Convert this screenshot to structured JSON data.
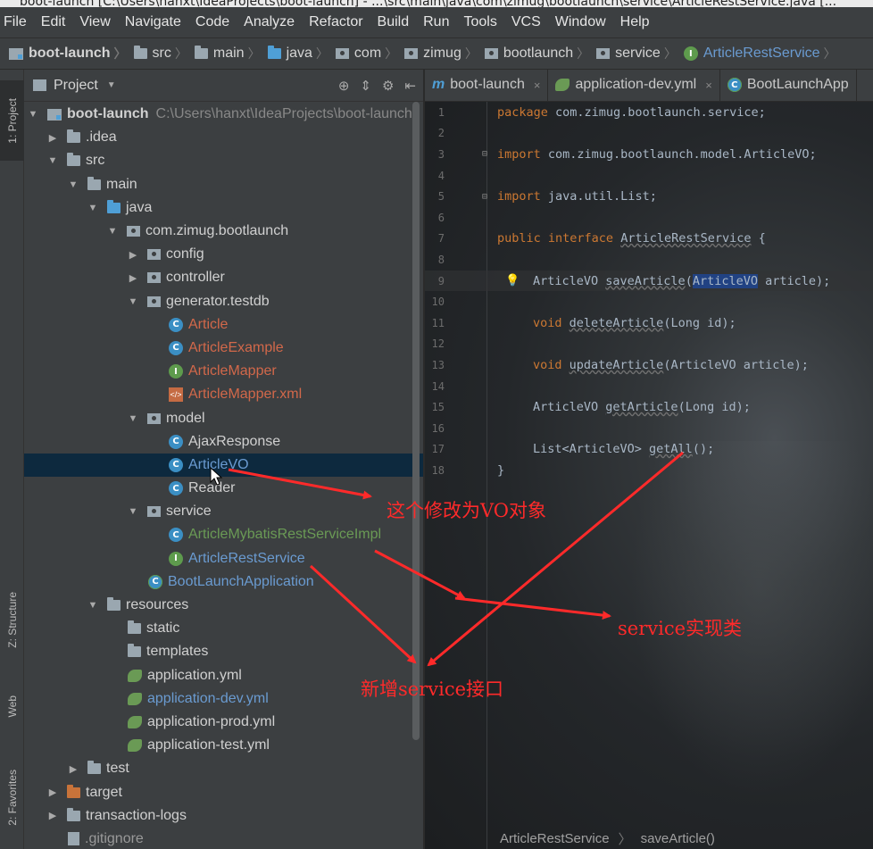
{
  "window": {
    "title": "boot-launch [C:\\Users\\hanxt\\IdeaProjects\\boot-launch] - ...\\src\\main\\java\\com\\zimug\\bootlaunch\\service\\ArticleRestService.java [..."
  },
  "menu": [
    "File",
    "Edit",
    "View",
    "Navigate",
    "Code",
    "Analyze",
    "Refactor",
    "Build",
    "Run",
    "Tools",
    "VCS",
    "Window",
    "Help"
  ],
  "breadcrumb": [
    "boot-launch",
    "src",
    "main",
    "java",
    "com",
    "zimug",
    "bootlaunch",
    "service",
    "ArticleRestService"
  ],
  "left_tabs": {
    "project": "1: Project",
    "structure": "Z: Structure",
    "web": "Web",
    "favorites": "2: Favorites"
  },
  "project_panel": {
    "title": "Project",
    "tree": [
      {
        "label": "boot-launch",
        "path": "C:\\Users\\hanxt\\IdeaProjects\\boot-launch"
      },
      {
        "label": ".idea"
      },
      {
        "label": "src"
      },
      {
        "label": "main"
      },
      {
        "label": "java"
      },
      {
        "label": "com.zimug.bootlaunch"
      },
      {
        "label": "config"
      },
      {
        "label": "controller"
      },
      {
        "label": "generator.testdb"
      },
      {
        "label": "Article"
      },
      {
        "label": "ArticleExample"
      },
      {
        "label": "ArticleMapper"
      },
      {
        "label": "ArticleMapper.xml"
      },
      {
        "label": "model"
      },
      {
        "label": "AjaxResponse"
      },
      {
        "label": "ArticleVO"
      },
      {
        "label": "Reader"
      },
      {
        "label": "service"
      },
      {
        "label": "ArticleMybatisRestServiceImpl"
      },
      {
        "label": "ArticleRestService"
      },
      {
        "label": "BootLaunchApplication"
      },
      {
        "label": "resources"
      },
      {
        "label": "static"
      },
      {
        "label": "templates"
      },
      {
        "label": "application.yml"
      },
      {
        "label": "application-dev.yml"
      },
      {
        "label": "application-prod.yml"
      },
      {
        "label": "application-test.yml"
      },
      {
        "label": "test"
      },
      {
        "label": "target"
      },
      {
        "label": "transaction-logs"
      },
      {
        "label": ".gitignore"
      }
    ]
  },
  "editor": {
    "tabs": [
      "boot-launch",
      "application-dev.yml",
      "BootLaunchApp"
    ],
    "lines": {
      "l1": "com.zimug.bootlaunch.service;",
      "l3": "com.zimug.bootlaunch.model.ArticleVO;",
      "l5": "java.util.List;",
      "l7_kw": "public interface",
      "l7_name": "ArticleRestService",
      "l7_end": " {",
      "l9_type": "ArticleVO ",
      "l9_fn": "saveArticle",
      "l9_p1": "(",
      "l9_hl": "ArticleVO",
      "l9_end": " article);",
      "l11_kw": "void ",
      "l11_fn": "deleteArticle",
      "l11_end": "(Long id);",
      "l13_kw": "void ",
      "l13_fn": "updateArticle",
      "l13_end": "(ArticleVO article);",
      "l15_type": "ArticleVO ",
      "l15_fn": "getArticle",
      "l15_end": "(Long id);",
      "l17_type": "List<ArticleVO> ",
      "l17_fn": "getAll",
      "l17_end": "();",
      "l18": "}",
      "kw_package": "package ",
      "kw_import": "import "
    },
    "line_numbers": [
      "1",
      "2",
      "3",
      "4",
      "5",
      "6",
      "7",
      "8",
      "9",
      "10",
      "11",
      "12",
      "13",
      "14",
      "15",
      "16",
      "17",
      "18"
    ],
    "status": {
      "class": "ArticleRestService",
      "method": "saveArticle()"
    }
  },
  "annotations": {
    "vo": "这个修改为VO对象",
    "impl": "service实现类",
    "iface": "新增service接口",
    "color": "#ff2a2a"
  }
}
